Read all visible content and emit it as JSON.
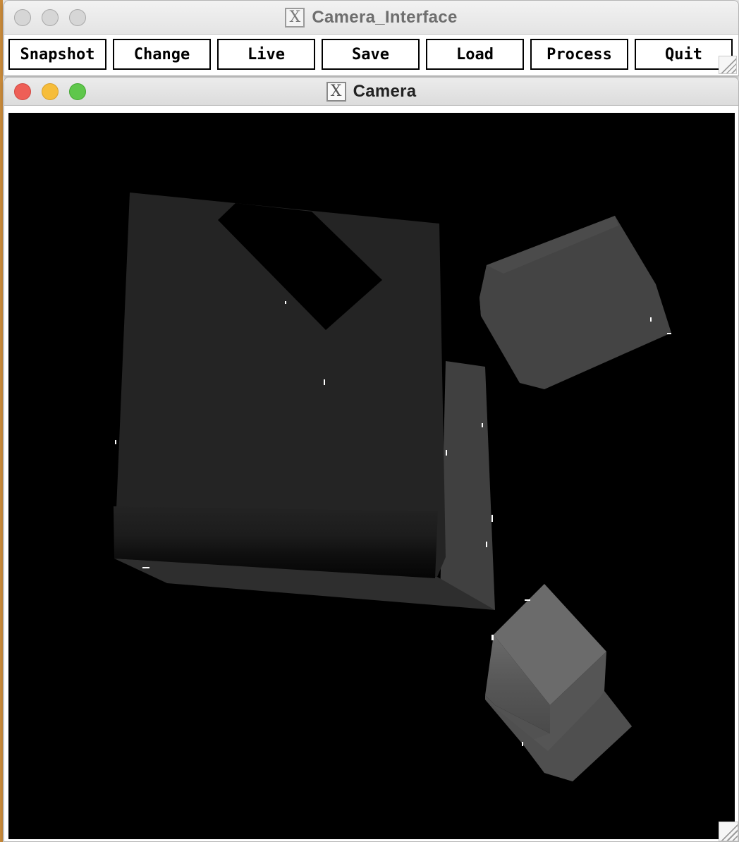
{
  "interface_window": {
    "title": "Camera_Interface",
    "buttons": [
      {
        "id": "snapshot",
        "label": "Snapshot"
      },
      {
        "id": "change",
        "label": "Change"
      },
      {
        "id": "live",
        "label": "Live"
      },
      {
        "id": "save",
        "label": "Save"
      },
      {
        "id": "load",
        "label": "Load"
      },
      {
        "id": "process",
        "label": "Process"
      },
      {
        "id": "quit",
        "label": "Quit"
      }
    ]
  },
  "camera_window": {
    "title": "Camera"
  },
  "colors": {
    "canvas_background": "#000000",
    "traffic_red": "#ee5f57",
    "traffic_yellow": "#f6bd3b",
    "traffic_green": "#5fc74b"
  }
}
